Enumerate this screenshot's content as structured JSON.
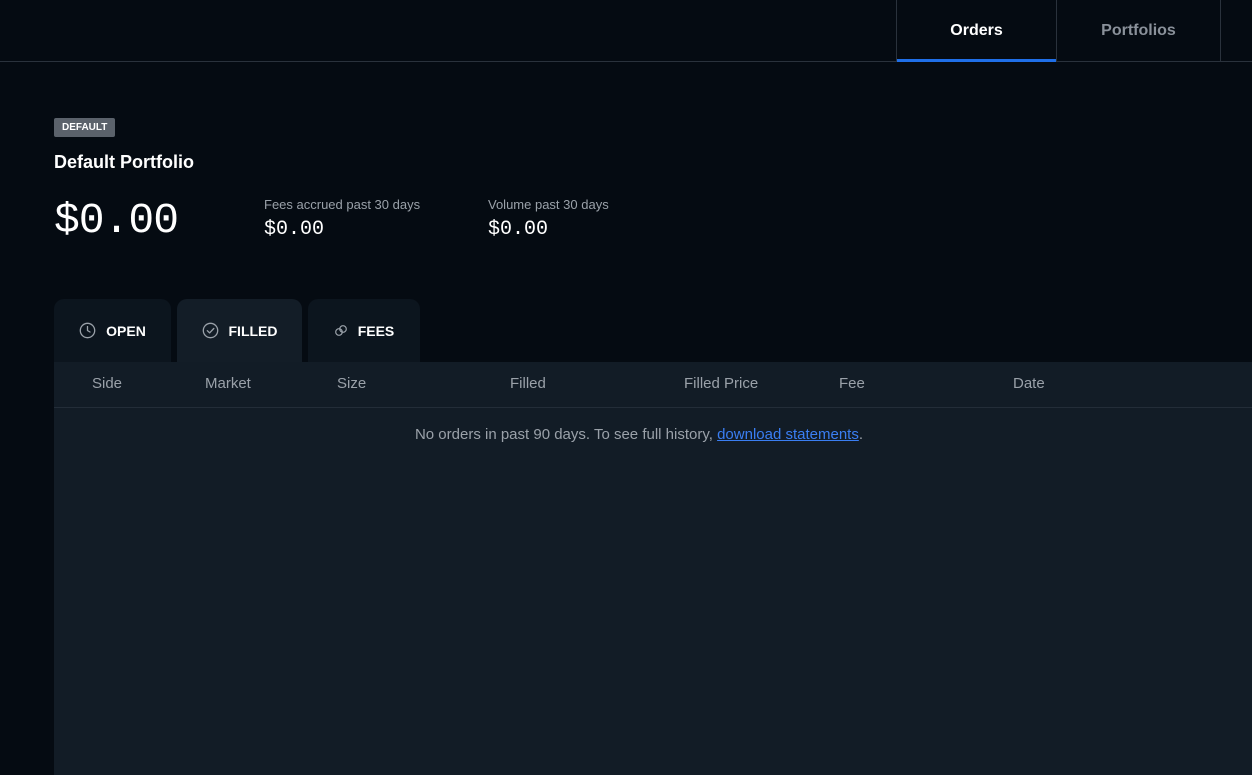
{
  "top_nav": {
    "tabs": [
      {
        "label": "Orders",
        "active": true
      },
      {
        "label": "Portfolios",
        "active": false
      }
    ]
  },
  "portfolio": {
    "badge": "DEFAULT",
    "name": "Default Portfolio",
    "balance": "$0.00",
    "stats": {
      "fees_label": "Fees accrued past 30 days",
      "fees_value": "$0.00",
      "volume_label": "Volume past 30 days",
      "volume_value": "$0.00"
    }
  },
  "order_tabs": [
    {
      "label": "OPEN",
      "icon": "clock-icon",
      "active": false
    },
    {
      "label": "FILLED",
      "icon": "check-circle-icon",
      "active": true
    },
    {
      "label": "FEES",
      "icon": "fees-icon",
      "active": false
    }
  ],
  "table": {
    "columns": [
      "Side",
      "Market",
      "Size",
      "Filled",
      "Filled Price",
      "Fee",
      "Date"
    ],
    "empty_text": "No orders in past 90 days. To see full history, ",
    "empty_link": "download statements",
    "empty_suffix": "."
  },
  "colors": {
    "background": "#050b12",
    "panel": "#121c26",
    "accent": "#1f6fe8",
    "link": "#3a7ef2",
    "muted_text": "#9aa1a9"
  }
}
